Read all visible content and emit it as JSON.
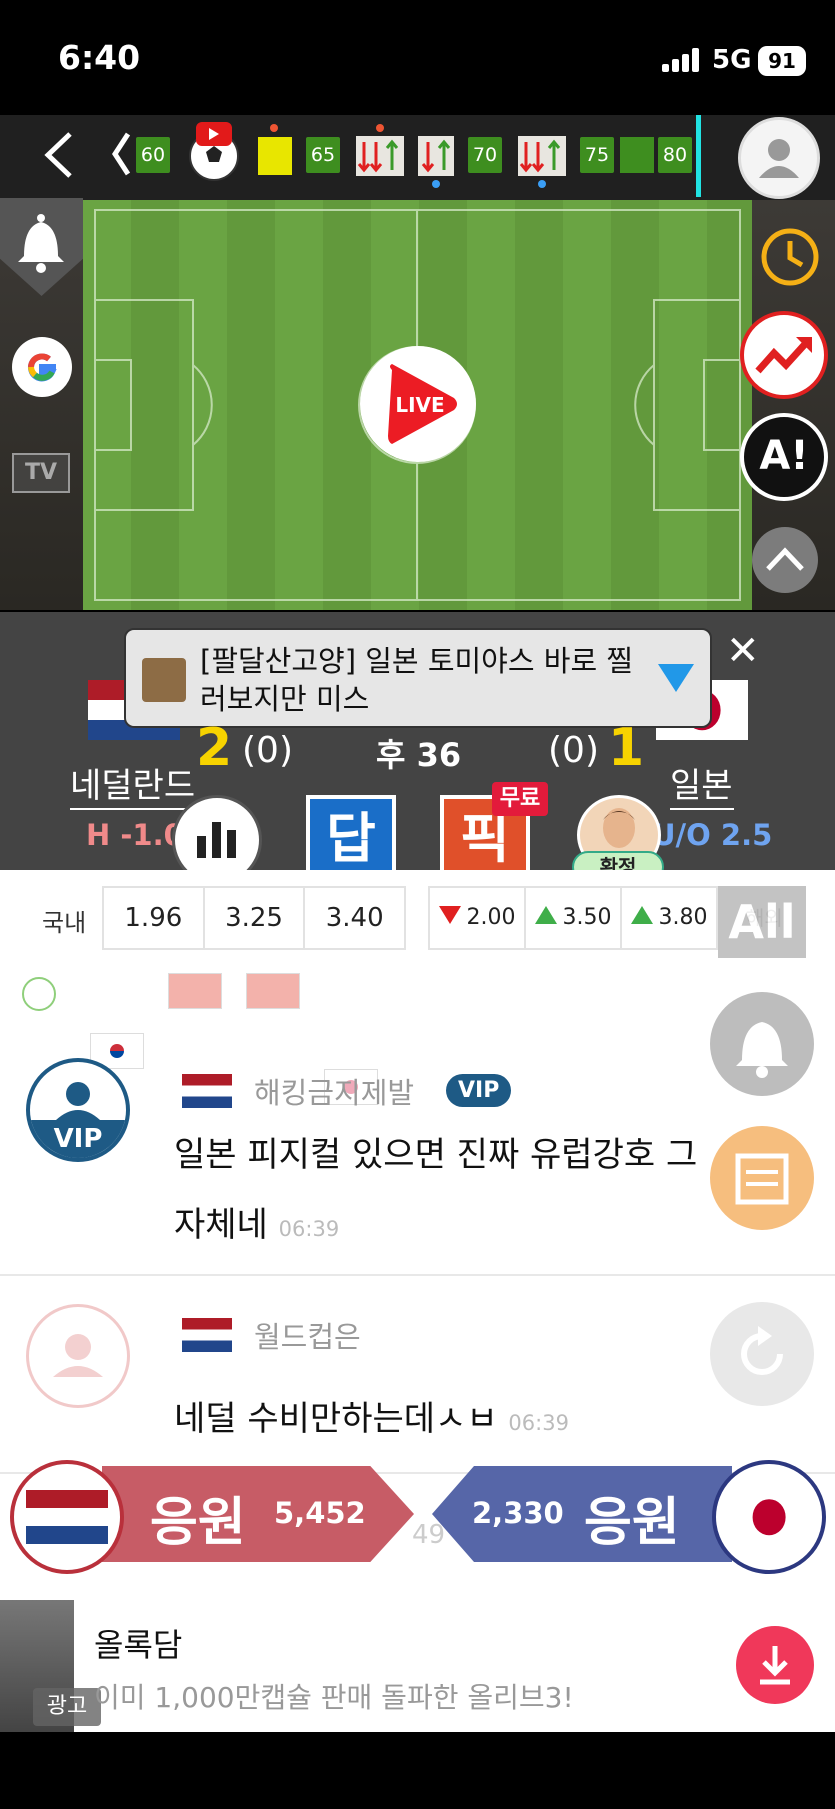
{
  "status_bar": {
    "time": "6:40",
    "network": "5G",
    "battery": "91"
  },
  "timeline": {
    "minutes": [
      "60",
      "65",
      "70",
      "75",
      "80"
    ]
  },
  "pitch": {
    "live_label": "LIVE",
    "tv_label": "TV",
    "ai_label": "A!"
  },
  "popup": {
    "text": "[팔달산고양] 일본 토미야스 바로 찔러보지만 미스"
  },
  "score": {
    "home_score": "2",
    "home_ht": "(0)",
    "period": "후 36",
    "away_ht": "(0)",
    "away_score": "1",
    "home_team": "네덜란드",
    "away_team": "일본",
    "handicap": "H -1.0",
    "over_under": "U/O 2.5"
  },
  "buttons": {
    "dap": "답",
    "pick": "픽",
    "free": "무료",
    "confirm": "확정"
  },
  "odds": {
    "label": "국내",
    "domestic": [
      "1.96",
      "3.25",
      "3.40"
    ],
    "handicap_odds": [
      "2.00",
      "3.50",
      "3.80"
    ],
    "all_label": "All",
    "extra": "해외"
  },
  "messages": [
    {
      "nickname": "해킹금지제발",
      "badge": "VIP",
      "avatar_label": "VIP",
      "text": "일본 피지컬 있으면 진짜 유럽강호 그자체네",
      "time": "06:39"
    },
    {
      "nickname": "월드컵은",
      "text": "네덜 수비만하는데ㅅㅂ",
      "time": "06:39"
    }
  ],
  "partial_time": "49",
  "cheer": {
    "home_label": "응원",
    "home_count": "5,452",
    "away_label": "응원",
    "away_count": "2,330"
  },
  "ad": {
    "title": "올록담",
    "desc": "이미 1,000만캡슐 판매 돌파한 올리브3!",
    "badge": "광고"
  },
  "colors": {
    "pitch_green": "#6aa443",
    "home_cheer": "#c75c66",
    "away_cheer": "#5666a8",
    "score_yellow": "#f7d300"
  }
}
